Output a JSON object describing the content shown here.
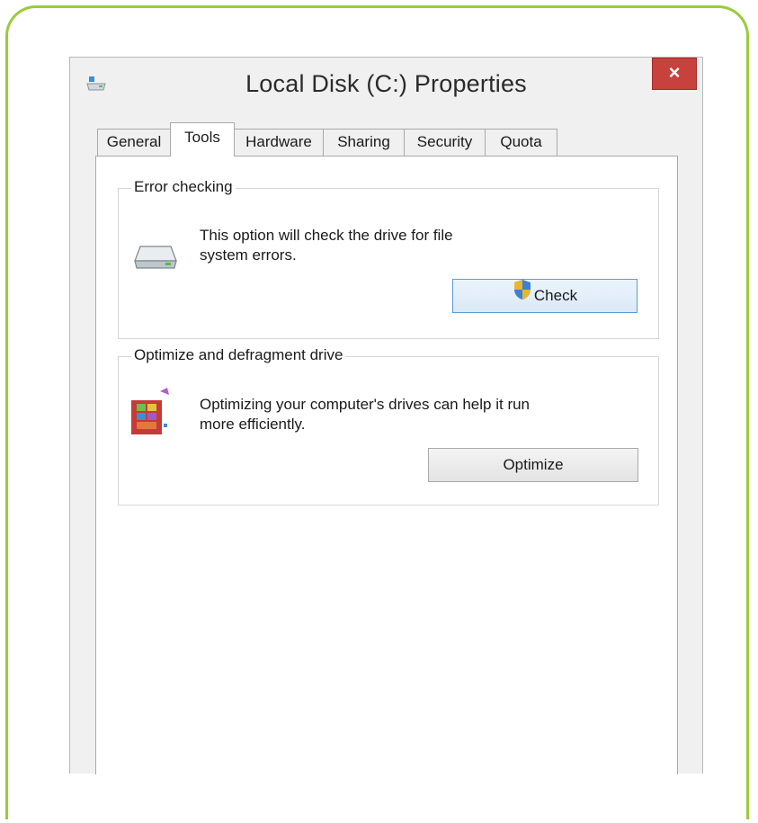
{
  "window": {
    "title": "Local Disk (C:) Properties",
    "close_label": "×"
  },
  "tabs": [
    {
      "label": "General"
    },
    {
      "label": "Tools"
    },
    {
      "label": "Hardware"
    },
    {
      "label": "Sharing"
    },
    {
      "label": "Security"
    },
    {
      "label": "Quota"
    }
  ],
  "active_tab": "Tools",
  "error_checking": {
    "label": "Error checking",
    "description_line1": "This option will check the drive for file",
    "description_line2": "system errors.",
    "button_label": "Check"
  },
  "optimize": {
    "label": "Optimize and defragment drive",
    "description_line1": "Optimizing your computer's drives can help it run",
    "description_line2": "more efficiently.",
    "button_label": "Optimize"
  },
  "colors": {
    "frame_border": "#9acb3c",
    "close_button": "#c7413d",
    "focus_border": "#5b9bd5"
  },
  "icons": {
    "title": "drive-icon",
    "error_checking": "hard-drive-icon",
    "optimize": "defragment-icon",
    "check_button": "uac-shield-icon"
  }
}
